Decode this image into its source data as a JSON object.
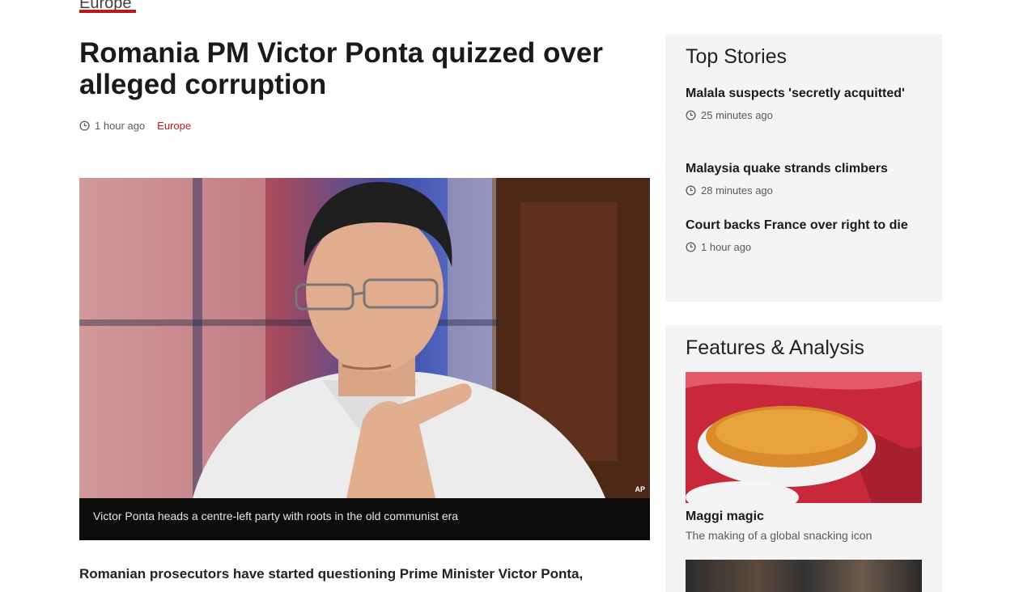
{
  "section": {
    "label": "Europe"
  },
  "article": {
    "headline": "Romania PM Victor Ponta quizzed over alleged corruption",
    "time": "1 hour ago",
    "section_link": "Europe",
    "image": {
      "caption": "Victor Ponta heads a centre-left party with roots in the old communist era",
      "credit": "AP"
    },
    "first_line": "Romanian prosecutors have started questioning Prime Minister Victor Ponta,"
  },
  "top_stories": {
    "heading": "Top Stories",
    "items": [
      {
        "title": "Malala suspects 'secretly acquitted'",
        "time": "25 minutes ago"
      },
      {
        "title": "Malaysia quake strands climbers",
        "time": "28 minutes ago"
      },
      {
        "title": "Court backs France over right to die",
        "time": "1 hour ago"
      }
    ]
  },
  "features": {
    "heading": "Features & Analysis",
    "items": [
      {
        "title": "Maggi magic",
        "summary": "The making of a global snacking icon"
      }
    ]
  },
  "colors": {
    "accent": "#bb1919",
    "panel_bg": "#f4f4f4",
    "caption_bg": "#0c0c0c"
  },
  "icons": {
    "time": "clock-icon"
  }
}
